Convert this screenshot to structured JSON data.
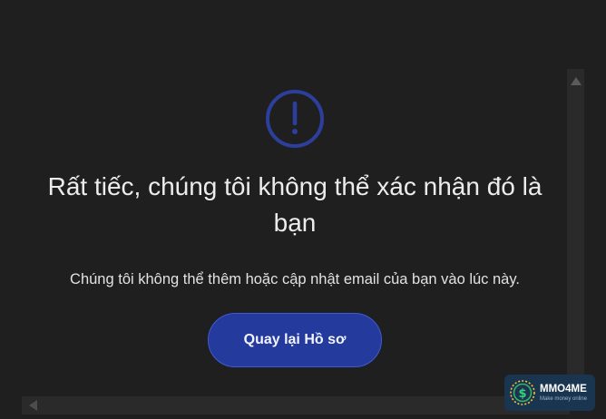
{
  "dialog": {
    "title": "Rất tiếc, chúng tôi không thể xác nhận đó là bạn",
    "message": "Chúng tôi không thể thêm hoặc cập nhật email của bạn vào lúc này.",
    "button_label": "Quay lại Hồ sơ",
    "icon": "exclamation-circle-icon"
  },
  "watermark": {
    "name": "MMO4ME",
    "tagline": "Make money online"
  },
  "colors": {
    "background": "#1f1f20",
    "accent": "#243a9c",
    "icon": "#2c3f9c",
    "text": "#ececec"
  }
}
